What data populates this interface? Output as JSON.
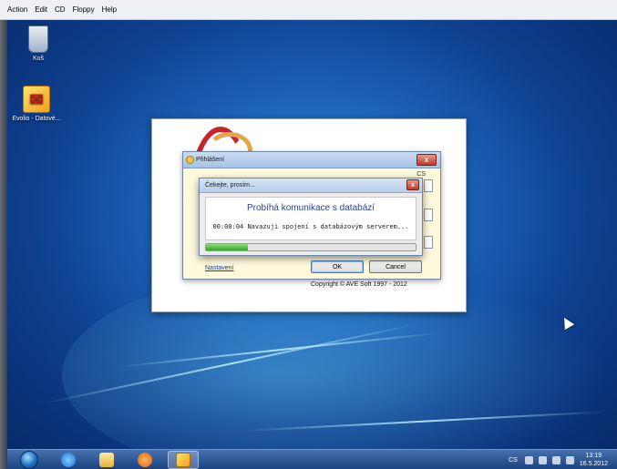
{
  "vm_menu": [
    "Action",
    "Edit",
    "CD",
    "Floppy",
    "Help"
  ],
  "desktop_icons": [
    {
      "label": "Koš",
      "icon": "recycle-bin-icon"
    },
    {
      "label": "Evolio - Datové...",
      "icon": "evolio-icon"
    }
  ],
  "splash": {
    "copyright": "Copyright © AVE Soft 1997 - 2012"
  },
  "login_dialog": {
    "title": "Přihlášení",
    "close_label": "x",
    "field_label": "CS",
    "settings_link": "Nastavení",
    "ok_label": "OK",
    "cancel_label": "Cancel"
  },
  "wait_dialog": {
    "title": "Čekejte, prosím...",
    "close_label": "x",
    "headline": "Probíhá komunikace s databází",
    "status": "00:00:04 Navazuji spojení s databázovým serverem...",
    "progress": 0.2
  },
  "taskbar": {
    "apps": [
      "internet-explorer-icon",
      "folder-icon",
      "media-player-icon",
      "evolio-icon"
    ],
    "language": "CS",
    "time": "13:19",
    "date": "16.5.2012"
  },
  "colors": {
    "desktop": "#1c62b8",
    "headline": "#2c3e9a",
    "progress": "#2fa52a",
    "close": "#c0392b"
  }
}
